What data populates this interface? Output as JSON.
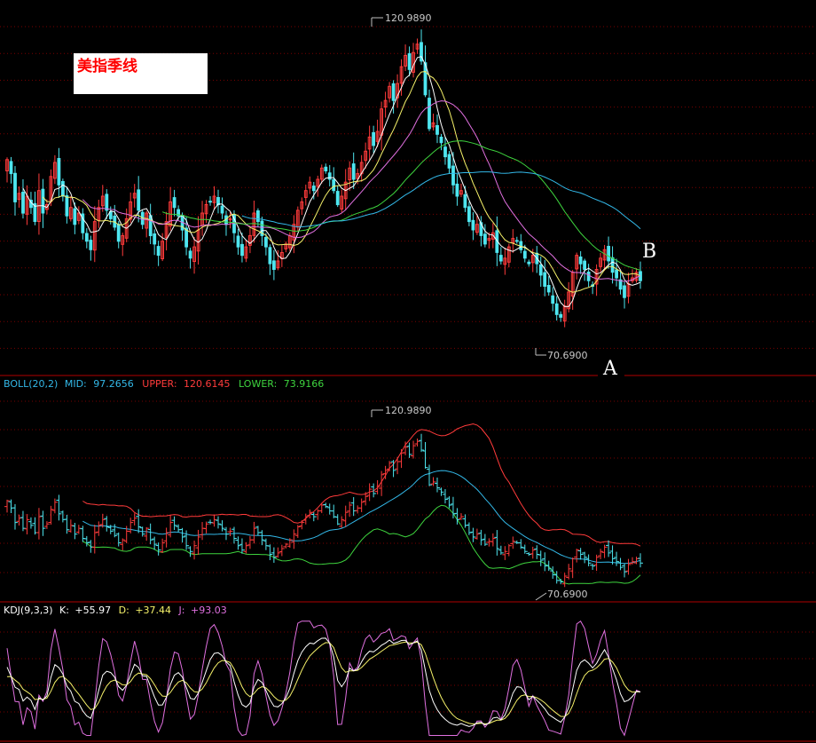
{
  "chart_data": {
    "type": "candlestick",
    "title": "美指季线",
    "annotations": {
      "point_a": "A",
      "point_b": "B"
    },
    "price_panel": {
      "high_label": "120.9890",
      "low_label": "70.6900",
      "ylim": [
        64,
        125
      ]
    },
    "boll_panel": {
      "indicator": "BOLL(20,2)",
      "mid_label": "MID:",
      "upper_label": "UPPER:",
      "lower_label": "LOWER:",
      "mid": "97.2656",
      "upper": "120.6145",
      "lower": "73.9166",
      "high_label": "120.9890",
      "low_label": "70.6900",
      "ylim": [
        64,
        136
      ]
    },
    "kdj_panel": {
      "indicator": "KDJ(9,3,3)",
      "k_label": "K:",
      "d_label": "D:",
      "j_label": "J:",
      "k": "+55.97",
      "d": "+37.44",
      "j": "+93.03",
      "ylim": [
        -5,
        112
      ]
    },
    "colors": {
      "up": "#ff3b3b",
      "down": "#4ee6f0",
      "ma5": "#ffffff",
      "ma10": "#f6f26a",
      "ma20": "#e070e0",
      "ma40": "#3ed43e",
      "ma60": "#33b8e8",
      "boll_mid": "#33b8e8",
      "boll_upper": "#ff3b3b",
      "boll_lower": "#3ed43e",
      "kdj_k": "#ffffff",
      "kdj_d": "#f6f26a",
      "kdj_j": "#e070e0",
      "grid": "#7a0000",
      "border": "#b00000"
    },
    "closes": [
      99.5,
      97.0,
      92.0,
      93.5,
      90.0,
      93.0,
      91.0,
      88.5,
      94.0,
      90.0,
      91.5,
      96.5,
      99.0,
      95.0,
      93.0,
      89.5,
      91.0,
      88.0,
      90.0,
      86.5,
      85.0,
      83.5,
      88.5,
      91.0,
      93.0,
      90.5,
      89.0,
      87.5,
      85.0,
      86.0,
      89.0,
      92.0,
      93.5,
      90.5,
      88.0,
      90.0,
      86.0,
      84.5,
      82.5,
      85.0,
      88.5,
      92.0,
      91.0,
      89.5,
      87.0,
      84.0,
      82.0,
      84.0,
      87.0,
      90.0,
      91.5,
      92.0,
      93.0,
      91.5,
      90.0,
      88.0,
      89.0,
      86.5,
      84.0,
      82.5,
      84.0,
      86.0,
      90.0,
      88.5,
      86.0,
      84.0,
      81.0,
      80.0,
      81.5,
      83.0,
      84.5,
      86.0,
      88.0,
      90.5,
      92.0,
      94.0,
      95.5,
      94.0,
      96.0,
      98.0,
      97.5,
      96.0,
      94.0,
      91.5,
      93.0,
      95.5,
      98.0,
      96.0,
      97.0,
      99.0,
      101.0,
      103.5,
      102.0,
      104.5,
      108.5,
      110.0,
      112.5,
      110.0,
      113.0,
      116.0,
      118.0,
      115.5,
      118.5,
      120.0,
      117.0,
      111.0,
      105.0,
      106.0,
      104.0,
      102.5,
      100.0,
      98.0,
      95.0,
      93.0,
      94.0,
      91.0,
      88.5,
      87.0,
      88.0,
      86.0,
      84.5,
      85.5,
      86.5,
      83.0,
      81.5,
      82.0,
      84.0,
      85.5,
      85.0,
      83.5,
      82.0,
      81.0,
      82.5,
      81.0,
      79.0,
      77.0,
      76.0,
      74.0,
      72.0,
      71.5,
      73.5,
      76.0,
      79.5,
      82.5,
      81.0,
      80.0,
      78.0,
      77.0,
      80.0,
      82.0,
      83.5,
      81.5,
      79.5,
      78.5,
      76.5,
      75.0,
      77.5,
      78.5,
      79.5,
      78.0
    ]
  }
}
